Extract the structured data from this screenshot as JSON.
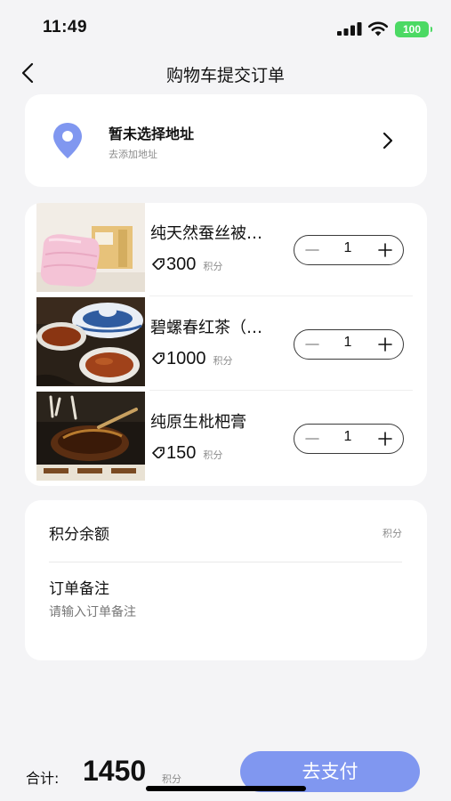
{
  "status_bar": {
    "time": "11:49",
    "battery": "100"
  },
  "nav": {
    "title": "购物车提交订单",
    "back_icon": "chevron-left-icon"
  },
  "address": {
    "title": "暂未选择地址",
    "subtitle": "去添加地址",
    "icon": "location-pin-icon",
    "accent_color": "#8097f0"
  },
  "goods": [
    {
      "name": "纯天然蚕丝被…",
      "price": "300",
      "unit": "积分",
      "quantity": "1",
      "image": "silk-quilt-image"
    },
    {
      "name": "碧螺春红茶（…",
      "price": "1000",
      "unit": "积分",
      "quantity": "1",
      "image": "black-tea-image"
    },
    {
      "name": "纯原生枇杷膏",
      "price": "150",
      "unit": "积分",
      "quantity": "1",
      "image": "loquat-paste-image"
    }
  ],
  "info": {
    "balance_label": "积分余额",
    "balance_unit": "积分",
    "remark_label": "订单备注",
    "remark_placeholder": "请输入订单备注"
  },
  "footer": {
    "total_label": "合计:",
    "total_value": "1450",
    "total_unit": "积分",
    "pay_label": "去支付",
    "pay_color": "#8097f0"
  }
}
